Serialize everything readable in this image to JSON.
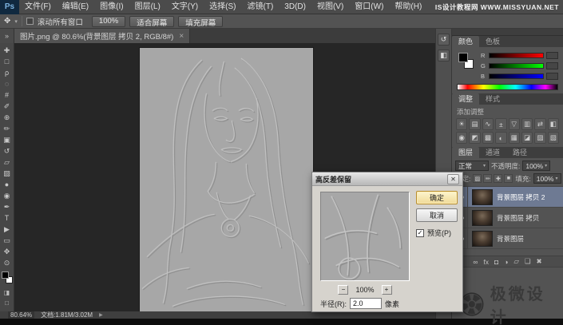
{
  "menu_bar": {
    "logo": "Ps",
    "items": [
      "文件(F)",
      "编辑(E)",
      "图像(I)",
      "图层(L)",
      "文字(Y)",
      "选择(S)",
      "滤镜(T)",
      "3D(D)",
      "视图(V)",
      "窗口(W)",
      "帮助(H)"
    ],
    "site_watermark": "IS设计教程网 WWW.MISSYUAN.NET"
  },
  "options_bar": {
    "hand_tool_glyph": "✥",
    "dropdown_glyph": "▾",
    "scroll_all_label": "滚动所有窗口",
    "buttons": [
      "100%",
      "适合屏幕",
      "填充屏幕"
    ]
  },
  "tab_bar": {
    "collapse_glyph": "»",
    "document_title": "图片.png @ 80.6%(背景图层 拷贝 2, RGB/8#)",
    "close_glyph": "×"
  },
  "toolbox": {
    "tools": [
      {
        "name": "move",
        "glyph": "✚"
      },
      {
        "name": "marquee",
        "glyph": "□"
      },
      {
        "name": "lasso",
        "glyph": "ρ"
      },
      {
        "name": "quick-selection",
        "glyph": "◌"
      },
      {
        "name": "crop",
        "glyph": "#"
      },
      {
        "name": "eyedropper",
        "glyph": "✐"
      },
      {
        "name": "healing-brush",
        "glyph": "⊕"
      },
      {
        "name": "brush",
        "glyph": "✏"
      },
      {
        "name": "clone-stamp",
        "glyph": "▣"
      },
      {
        "name": "history-brush",
        "glyph": "↺"
      },
      {
        "name": "eraser",
        "glyph": "▱"
      },
      {
        "name": "gradient",
        "glyph": "▨"
      },
      {
        "name": "blur",
        "glyph": "●"
      },
      {
        "name": "dodge",
        "glyph": "◉"
      },
      {
        "name": "pen",
        "glyph": "✒"
      },
      {
        "name": "type",
        "glyph": "T"
      },
      {
        "name": "path-selection",
        "glyph": "▶"
      },
      {
        "name": "shape",
        "glyph": "▭"
      },
      {
        "name": "hand",
        "glyph": "✥"
      },
      {
        "name": "zoom",
        "glyph": "⊙"
      }
    ],
    "extras": [
      {
        "name": "quick-mask",
        "glyph": "◨"
      },
      {
        "name": "screen-mode",
        "glyph": "□"
      }
    ]
  },
  "status_bar": {
    "zoom": "80.64%",
    "doc_info": "文档:1.81M/3.02M",
    "expand_glyph": "▶"
  },
  "dock_strip": {
    "icons": [
      {
        "name": "history",
        "glyph": "↺"
      },
      {
        "name": "properties",
        "glyph": "◧"
      }
    ]
  },
  "color_panel": {
    "tabs": [
      {
        "label": "颜色",
        "active": true
      },
      {
        "label": "色板",
        "active": false
      }
    ],
    "menu_glyph": "≡",
    "channels": [
      "R",
      "G",
      "B"
    ],
    "slider_colors": [
      "#ff0000",
      "#00ff00",
      "#0000ff"
    ]
  },
  "adjustments_panel": {
    "tabs": [
      {
        "label": "调整",
        "active": true
      },
      {
        "label": "样式",
        "active": false
      }
    ],
    "menu_glyph": "≡",
    "header_label": "添加调整",
    "icons": [
      {
        "name": "brightness-contrast",
        "glyph": "☀"
      },
      {
        "name": "levels",
        "glyph": "▤"
      },
      {
        "name": "curves",
        "glyph": "∿"
      },
      {
        "name": "exposure",
        "glyph": "±"
      },
      {
        "name": "vibrance",
        "glyph": "▽"
      },
      {
        "name": "hue-saturation",
        "glyph": "▥"
      },
      {
        "name": "color-balance",
        "glyph": "⇄"
      },
      {
        "name": "black-white",
        "glyph": "◧"
      },
      {
        "name": "photo-filter",
        "glyph": "◉"
      },
      {
        "name": "channel-mixer",
        "glyph": "◩"
      },
      {
        "name": "color-lookup",
        "glyph": "▩"
      },
      {
        "name": "invert",
        "glyph": "◐"
      },
      {
        "name": "posterize",
        "glyph": "▦"
      },
      {
        "name": "threshold",
        "glyph": "◪"
      },
      {
        "name": "gradient-map",
        "glyph": "▨"
      },
      {
        "name": "selective-color",
        "glyph": "▧"
      }
    ]
  },
  "layers_panel": {
    "tabs": [
      {
        "label": "图层",
        "active": true
      },
      {
        "label": "通道",
        "active": false
      },
      {
        "label": "路径",
        "active": false
      }
    ],
    "menu_glyph": "≡",
    "blend_mode": "正常",
    "caret_glyph": "▾",
    "opacity_label": "不透明度:",
    "opacity_value": "100%",
    "lock_label": "锁定:",
    "lock_icons": [
      {
        "name": "lock-transparency",
        "glyph": "▨"
      },
      {
        "name": "lock-pixels",
        "glyph": "✏"
      },
      {
        "name": "lock-position",
        "glyph": "✚"
      },
      {
        "name": "lock-all",
        "glyph": "■"
      }
    ],
    "fill_label": "填充:",
    "fill_value": "100%",
    "layers": [
      {
        "name": "背景图层 拷贝 2",
        "selected": true
      },
      {
        "name": "背景图层 拷贝",
        "selected": false
      },
      {
        "name": "背景图层",
        "selected": false
      }
    ],
    "footer_icons": [
      {
        "name": "link-layers",
        "glyph": "∞"
      },
      {
        "name": "layer-style",
        "glyph": "fx"
      },
      {
        "name": "add-layer-mask",
        "glyph": "◘"
      },
      {
        "name": "new-adjustment-layer",
        "glyph": "◑"
      },
      {
        "name": "new-group",
        "glyph": "▱"
      },
      {
        "name": "new-layer",
        "glyph": "❏"
      },
      {
        "name": "delete-layer",
        "glyph": "✖"
      }
    ]
  },
  "dialog": {
    "title": "高反差保留",
    "close_glyph": "✕",
    "ok_label": "确定",
    "cancel_label": "取消",
    "check_glyph": "✓",
    "preview_label": "预览(P)",
    "zoom_out_glyph": "−",
    "zoom_value": "100%",
    "zoom_in_glyph": "+",
    "radius_label": "半径(R):",
    "radius_value": "2.0",
    "radius_unit": "像素"
  },
  "bottom_watermark": {
    "text": "极微设计"
  },
  "ui_colors": {
    "selected_layer": "#6e7a93",
    "default_button": "#f0da96",
    "canvas_gray": "#a7a7a7",
    "pasteboard": "#262626"
  }
}
